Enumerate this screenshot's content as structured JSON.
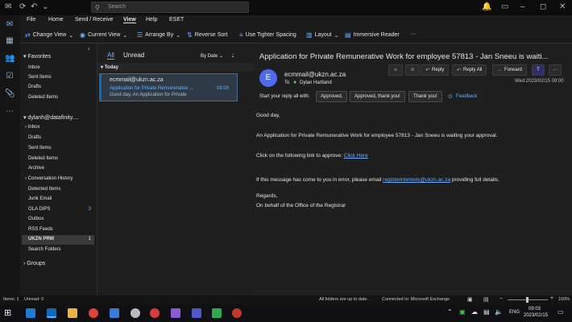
{
  "search": {
    "placeholder": "Search"
  },
  "menu": [
    "File",
    "Home",
    "Send / Receive",
    "View",
    "Help",
    "ESET"
  ],
  "menu_active": "View",
  "ribbon": {
    "change_view": "Change View",
    "current_view": "Current View",
    "arrange_by": "Arrange By",
    "reverse_sort": "Reverse Sort",
    "tighter": "Use Tighter Spacing",
    "layout": "Layout",
    "immersive": "Immersive Reader",
    "more": "···"
  },
  "favorites": {
    "header": "Favorites",
    "items": [
      "Inbox",
      "Sent Items",
      "Drafts",
      "Deleted Items"
    ]
  },
  "account": {
    "header": "dylanh@datafinity....",
    "items": [
      {
        "label": "Inbox",
        "count": "",
        "caret": true
      },
      {
        "label": "Drafts",
        "count": ""
      },
      {
        "label": "Sent Items",
        "count": ""
      },
      {
        "label": "Deleted Items",
        "count": ""
      },
      {
        "label": "Archive",
        "count": ""
      },
      {
        "label": "Conversation History",
        "count": "",
        "caret": true
      },
      {
        "label": "Detected Items",
        "count": ""
      },
      {
        "label": "Junk Email",
        "count": ""
      },
      {
        "label": "OLA DIPS",
        "count": "3"
      },
      {
        "label": "Outbox",
        "count": ""
      },
      {
        "label": "RSS Feeds",
        "count": ""
      },
      {
        "label": "UKZN PRW",
        "count": "1",
        "selected": true
      },
      {
        "label": "Search Folders",
        "count": ""
      }
    ]
  },
  "groups": "Groups",
  "list": {
    "tab_all": "All",
    "tab_unread": "Unread",
    "sort": "By Date",
    "sort_arrow": "↓",
    "group": "Today",
    "msg": {
      "from": "ecmmail@ukzn.ac.za",
      "subject": "Application for Private Remunerative ...",
      "time": "09:00",
      "preview": "Good day,  An Application for Private"
    }
  },
  "reading": {
    "subject": "Application for Private Remunerative Work for employee 57813 - Jan Sneeu is waiti...",
    "avatar": "E",
    "from": "ecmmail@ukzn.ac.za",
    "to_label": "To",
    "to": "Dylan Hartland",
    "reply": "Reply",
    "reply_all": "Reply All",
    "forward": "Forward",
    "date": "Wed 2023/02/15 09:00",
    "quick_prompt": "Start your reply all with:",
    "quick": [
      "Approved.",
      "Approved, thank you!",
      "Thank you!"
    ],
    "feedback": "Feedback",
    "greeting": "Good day,",
    "line1": "An Application for Private Remunerative Work for employee 57813 - Jan Sneeu is waiting your approval.",
    "line2_pre": "Click on the following link to approve: ",
    "line2_link": "Click Here",
    "line3_pre": "If this message has come to you in error, please email ",
    "line3_link": "registerinterests@ukzn.ac.za",
    "line3_post": " providing full details.",
    "regards": "Regards,",
    "sign": "On behalf of the Office of the Registrar"
  },
  "status": {
    "items": "Items: 1",
    "unread": "Unread: 0",
    "sync": "All folders are up to date.",
    "conn": "Connected to: Microsoft Exchange",
    "zoom": "100%"
  },
  "taskbar": {
    "lang": "ENG",
    "time": "09:03",
    "date": "2023/02/15"
  },
  "colors": {
    "accent": "#0f6cbd",
    "link": "#6bb0ff",
    "avatar": "#4f6bed"
  }
}
